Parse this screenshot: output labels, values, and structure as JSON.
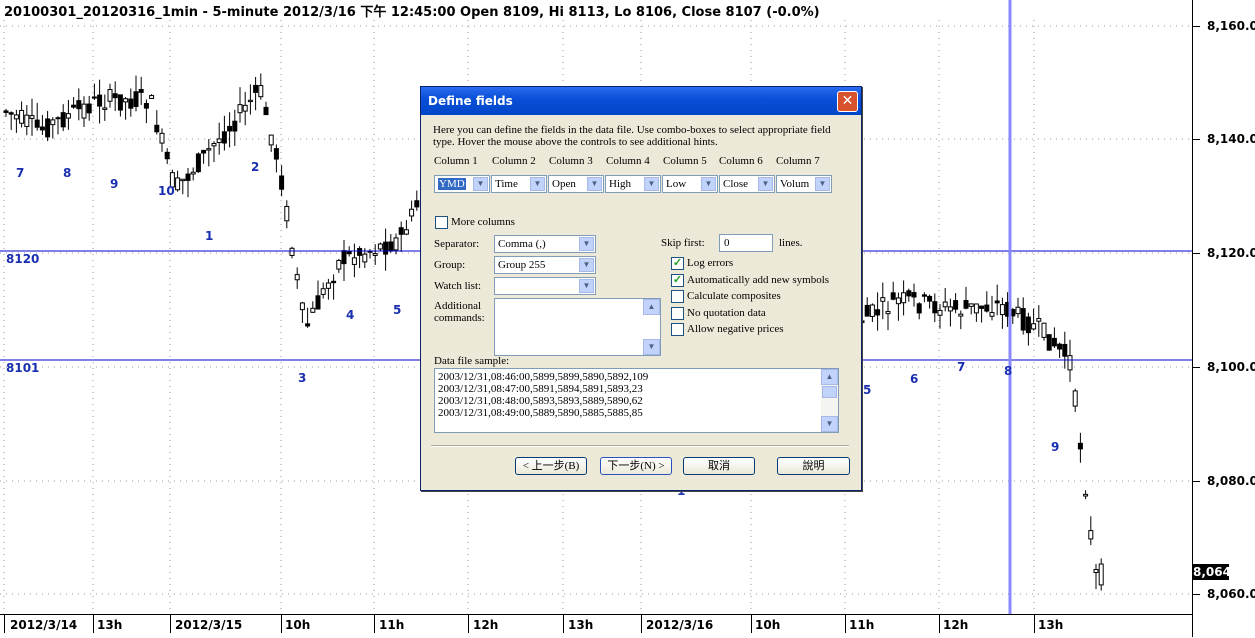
{
  "chart_title": "20100301_20120316_1min - 5-minute 2012/3/16 下午 12:45:00 Open 8109, Hi 8113, Lo 8106, Close 8107 (-0.0%)",
  "price_labels": [
    "8,160.0",
    "8,140.0",
    "8,120.0",
    "8,100.0",
    "8,080.0",
    "8,060.0"
  ],
  "last_price": "8,064",
  "time_labels": [
    "2012/3/14",
    "13h",
    "2012/3/15",
    "10h",
    "11h",
    "12h",
    "13h",
    "2012/3/16",
    "10h",
    "11h",
    "12h",
    "13h"
  ],
  "level_labels": [
    "8120",
    "8101"
  ],
  "wave_labels": [
    "7",
    "8",
    "9",
    "10",
    "1",
    "2",
    "3",
    "4",
    "5",
    "1",
    "5",
    "6",
    "7",
    "8",
    "9"
  ],
  "colors": {
    "level_line": "#0000cc",
    "cursor_line": "#8888ff",
    "wave_label": "#1a2fb0",
    "dialog_title": "#0a50d8"
  },
  "dialog": {
    "title": "Define fields",
    "close_icon": "close-icon",
    "description": "Here you can define the fields in the data file. Use combo-boxes to select appropriate field type. Hover the mouse above the controls to see additional hints.",
    "columns": [
      {
        "header": "Column 1",
        "value": "YMD"
      },
      {
        "header": "Column 2",
        "value": "Time"
      },
      {
        "header": "Column 3",
        "value": "Open"
      },
      {
        "header": "Column 4",
        "value": "High"
      },
      {
        "header": "Column 5",
        "value": "Low"
      },
      {
        "header": "Column 6",
        "value": "Close"
      },
      {
        "header": "Column 7",
        "value": "Volum"
      }
    ],
    "more_columns": "More columns",
    "separator_label": "Separator:",
    "separator_value": "Comma (,)",
    "group_label": "Group:",
    "group_value": "Group 255",
    "watchlist_label": "Watch list:",
    "watchlist_value": "",
    "additional_label_1": "Additional",
    "additional_label_2": "commands:",
    "skip_label": "Skip first:",
    "skip_value": "0",
    "skip_unit": "lines.",
    "checkboxes": [
      {
        "label": "Log errors",
        "checked": true
      },
      {
        "label": "Automatically add new symbols",
        "checked": true
      },
      {
        "label": "Calculate composites",
        "checked": false
      },
      {
        "label": "No quotation data",
        "checked": false
      },
      {
        "label": "Allow negative prices",
        "checked": false
      }
    ],
    "sample_label": "Data file sample:",
    "sample_lines": [
      "2003/12/31,08:46:00,5899,5899,5890,5892,109",
      "2003/12/31,08:47:00,5891,5894,5891,5893,23",
      "2003/12/31,08:48:00,5893,5893,5889,5890,62",
      "2003/12/31,08:49:00,5889,5890,5885,5885,85"
    ],
    "buttons": {
      "back": "< 上一步(B)",
      "next": "下一步(N) >",
      "cancel": "取消",
      "help": "說明"
    }
  }
}
